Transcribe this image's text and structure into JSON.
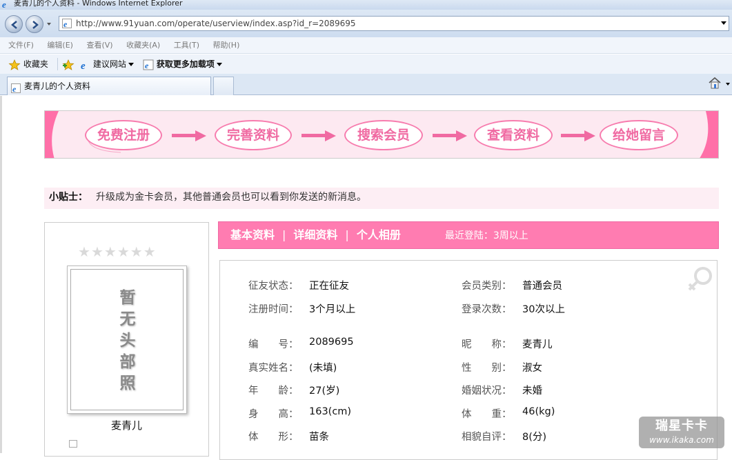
{
  "window": {
    "title": "麦青儿的个人资料 - Windows Internet Explorer",
    "address": "http://www.91yuan.com/operate/userview/index.asp?id_r=2089695"
  },
  "menu": [
    "文件(F)",
    "编辑(E)",
    "查看(V)",
    "收藏夹(A)",
    "工具(T)",
    "帮助(H)"
  ],
  "favorites": {
    "fav_label": "收藏夹",
    "suggested": "建议网站",
    "addons": "获取更多加载项"
  },
  "tab": {
    "title": "麦青儿的个人资料"
  },
  "banner": {
    "steps": [
      "免费注册",
      "完善资料",
      "搜索会员",
      "查看资料",
      "给她留言"
    ]
  },
  "tip": {
    "label": "小贴士：",
    "text": "升级成为金卡会员，其他普通会员也可以看到你发送的新消息。"
  },
  "profile": {
    "stars": 0,
    "photo_placeholder": [
      "暂",
      "无",
      "头",
      "部",
      "照"
    ],
    "name": "麦青儿"
  },
  "profile_tabs": {
    "basic": "基本资料",
    "detail": "详细资料",
    "album": "个人相册",
    "sep": "|",
    "last_login": "最近登陆：3周以上"
  },
  "info": {
    "status_label": "征友状态：",
    "status": "正在征友",
    "member_type_label": "会员类别：",
    "member_type": "普通会员",
    "reg_time_label": "注册时间：",
    "reg_time": "3个月以上",
    "login_count_label": "登录次数：",
    "login_count": "30次以上",
    "id_label": "编　　号：",
    "id": "2089695",
    "nickname_label": "昵　　称：",
    "nickname": "麦青儿",
    "realname_label": "真实姓名：",
    "realname": "(未填)",
    "gender_label": "性　　别：",
    "gender": "淑女",
    "age_label": "年　　龄：",
    "age": "27(岁)",
    "marriage_label": "婚姻状况：",
    "marriage": "未婚",
    "height_label": "身　　高：",
    "height": "163(cm)",
    "weight_label": "体　　重：",
    "weight": "46(kg)",
    "shape_label": "体　　形：",
    "shape": "苗条",
    "looks_label": "相貌自评：",
    "looks": "8(分)"
  },
  "watermark": {
    "line1": "瑞星卡卡",
    "line2": "www.ikaka.com"
  },
  "colors": {
    "pink": "#ff7cb1",
    "tip_bg": "#fdeef4"
  }
}
